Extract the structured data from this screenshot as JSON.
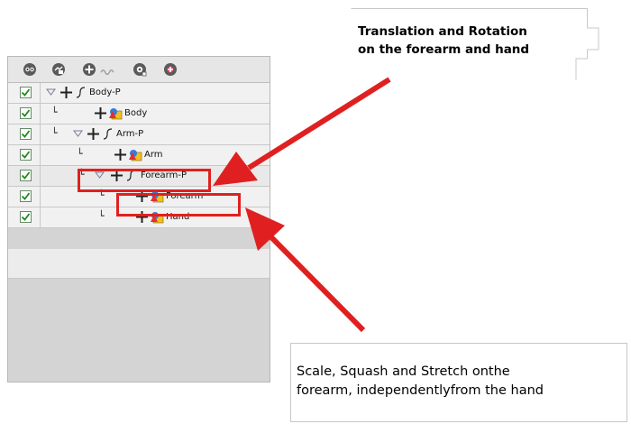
{
  "panel": {
    "toolbar_icons": [
      "eye-icon",
      "lock-icon",
      "add-layer-icon",
      "wave-icon",
      "cog-layer-icon",
      "color-layer-icon"
    ],
    "layers": [
      {
        "name": "Body-P",
        "type": "peg",
        "checked": true
      },
      {
        "name": "Body",
        "type": "drawing",
        "checked": true
      },
      {
        "name": "Arm-P",
        "type": "peg",
        "checked": true
      },
      {
        "name": "Arm",
        "type": "drawing",
        "checked": true
      },
      {
        "name": "Forearm-P",
        "type": "peg",
        "checked": true
      },
      {
        "name": "Forearm",
        "type": "drawing",
        "checked": true
      },
      {
        "name": "Hand",
        "type": "drawing",
        "checked": true
      }
    ]
  },
  "callouts": {
    "top": [
      "Translation and Rotation",
      "on the forearm and hand"
    ],
    "bottom": [
      "Scale, Squash and Stretch onthe",
      "forearm, independentlyfrom the hand"
    ]
  },
  "colors": {
    "highlight": "#e02020",
    "checkmark": "#1a8a1a",
    "panel_bg": "#d4d4d4"
  }
}
